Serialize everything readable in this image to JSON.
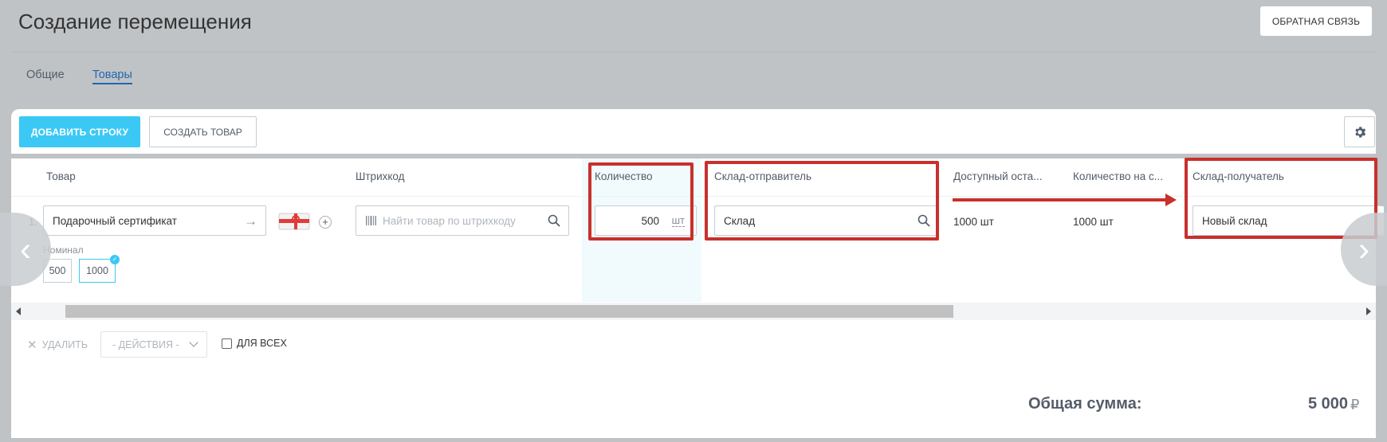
{
  "page": {
    "title": "Создание перемещения",
    "feedback_label": "ОБРАТНАЯ СВЯЗЬ"
  },
  "tabs": [
    {
      "label": "Общие",
      "active": false
    },
    {
      "label": "Товары",
      "active": true
    }
  ],
  "toolbar": {
    "add_row_label": "ДОБАВИТЬ СТРОКУ",
    "create_product_label": "СОЗДАТЬ ТОВАР",
    "settings_icon": "gear-icon"
  },
  "columns": {
    "product": "Товар",
    "barcode": "Штрихкод",
    "quantity": "Количество",
    "sender_store": "Склад-отправитель",
    "available": "Доступный оста...",
    "store_qty": "Количество на с...",
    "receiver_store": "Склад-получатель"
  },
  "row": {
    "index": "1.",
    "product_name": "Подарочный сертификат",
    "barcode_placeholder": "Найти товар по штрихкоду",
    "quantity_value": "500",
    "quantity_unit": "шт",
    "sender_store_value": "Склад",
    "available_value": "1000 шт",
    "store_qty_value": "1000 шт",
    "receiver_store_value": "Новый склад",
    "nominal_label": "Номинал",
    "nominal_options": [
      "500",
      "1000"
    ],
    "nominal_selected": "1000"
  },
  "footer": {
    "delete_label": "УДАЛИТЬ",
    "actions_placeholder": "- ДЕЙСТВИЯ -",
    "for_all_label": "ДЛЯ ВСЕХ",
    "total_label": "Общая сумма:",
    "total_value": "5 000",
    "currency": "₽"
  },
  "colors": {
    "accent": "#3bc8f5",
    "link": "#2067b0",
    "highlight": "#c8302c"
  }
}
